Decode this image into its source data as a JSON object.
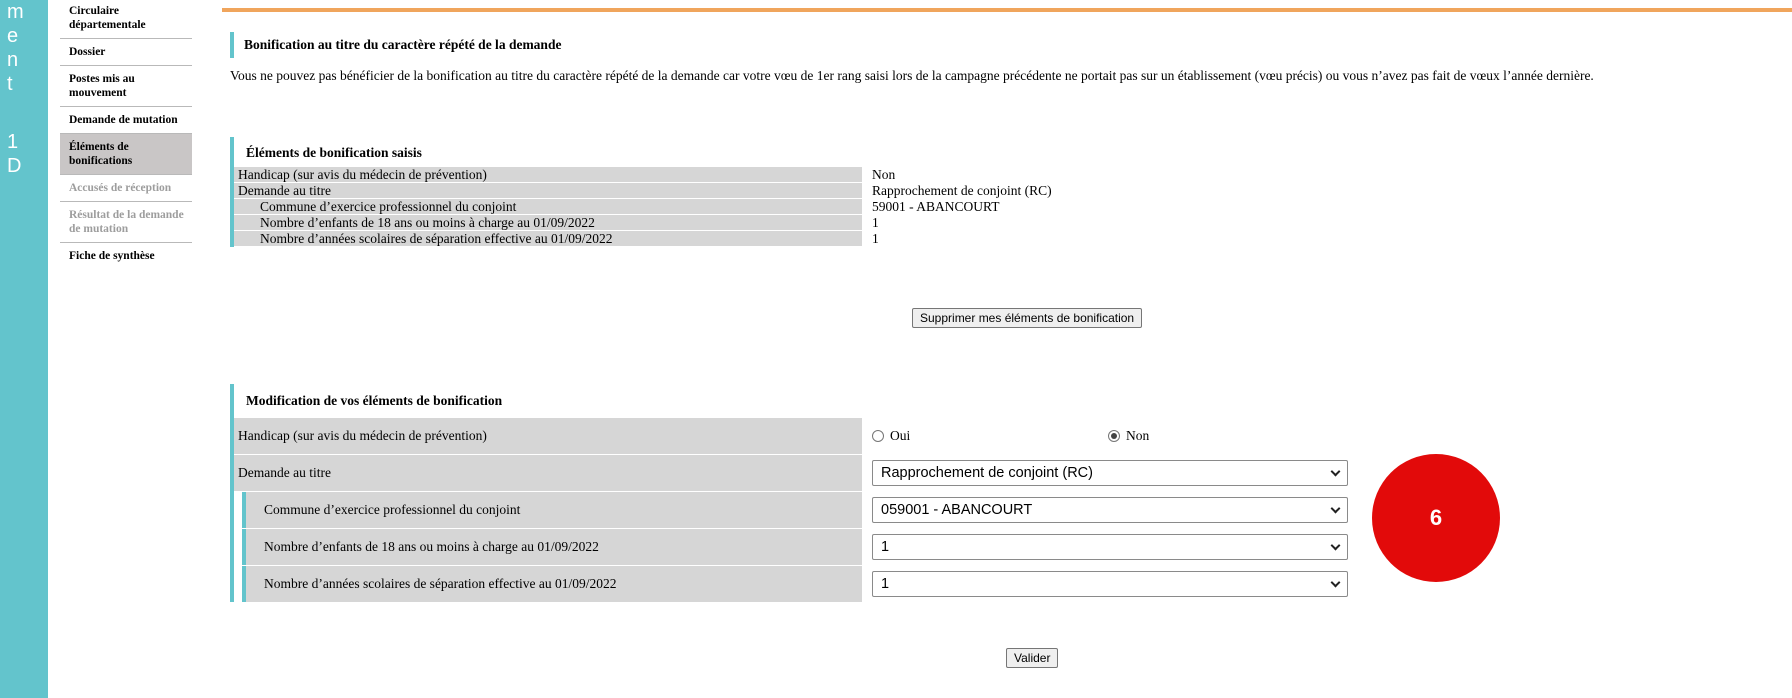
{
  "vertical_letters": [
    "m",
    "e",
    "n",
    "t",
    "",
    "1",
    "D"
  ],
  "nav": {
    "items": [
      {
        "label": "Circulaire départementale",
        "state": "normal"
      },
      {
        "label": "Dossier",
        "state": "normal"
      },
      {
        "label": "Postes mis au mouvement",
        "state": "normal"
      },
      {
        "label": "Demande de mutation",
        "state": "normal"
      },
      {
        "label": "Éléments de bonifications",
        "state": "active"
      },
      {
        "label": "Accusés de réception",
        "state": "disabled"
      },
      {
        "label": "Résultat de la demande de mutation",
        "state": "disabled"
      },
      {
        "label": "Fiche de synthèse",
        "state": "normal"
      }
    ]
  },
  "colors": {
    "accent": "#63c4cc",
    "top_rule": "#f0a55c",
    "badge": "#e20a0a",
    "row_bg": "#d6d6d6"
  },
  "repeat_section": {
    "title": "Bonification au titre du caractère répété de la demande",
    "message": "Vous ne pouvez pas bénéficier de la bonification au titre du caractère répété de la demande car votre vœu de 1er rang saisi lors de la campagne précédente ne portait pas sur un établissement (vœu précis) ou vous n’avez pas fait de vœux l’année dernière."
  },
  "saisis": {
    "title": "Éléments de bonification saisis",
    "rows": [
      {
        "label": "Handicap (sur avis du médecin de prévention)",
        "value": "Non",
        "indent": false
      },
      {
        "label": "Demande au titre",
        "value": "Rapprochement de conjoint (RC)",
        "indent": false
      },
      {
        "label": "Commune d’exercice professionnel du conjoint",
        "value": "59001 - ABANCOURT",
        "indent": true
      },
      {
        "label": "Nombre d’enfants de 18 ans ou moins à charge au 01/09/2022",
        "value": "1",
        "indent": true
      },
      {
        "label": "Nombre d’années scolaires de séparation effective au 01/09/2022",
        "value": "1",
        "indent": true
      }
    ],
    "delete_button": "Supprimer mes éléments de bonification"
  },
  "modif": {
    "title": "Modification de vos éléments de bonification",
    "handicap_label": "Handicap (sur avis du médecin de prévention)",
    "radio_yes": "Oui",
    "radio_no": "Non",
    "selected": "Non",
    "demande_label": "Demande au titre",
    "demande_value": "Rapprochement de conjoint (RC)",
    "commune_label": "Commune d’exercice professionnel du conjoint",
    "commune_value": "059001 - ABANCOURT",
    "enfants_label": "Nombre d’enfants de 18 ans ou moins à charge au 01/09/2022",
    "enfants_value": "1",
    "separation_label": "Nombre d’années scolaires de séparation effective au 01/09/2022",
    "separation_value": "1",
    "submit": "Valider"
  },
  "badge": {
    "number": "6"
  }
}
